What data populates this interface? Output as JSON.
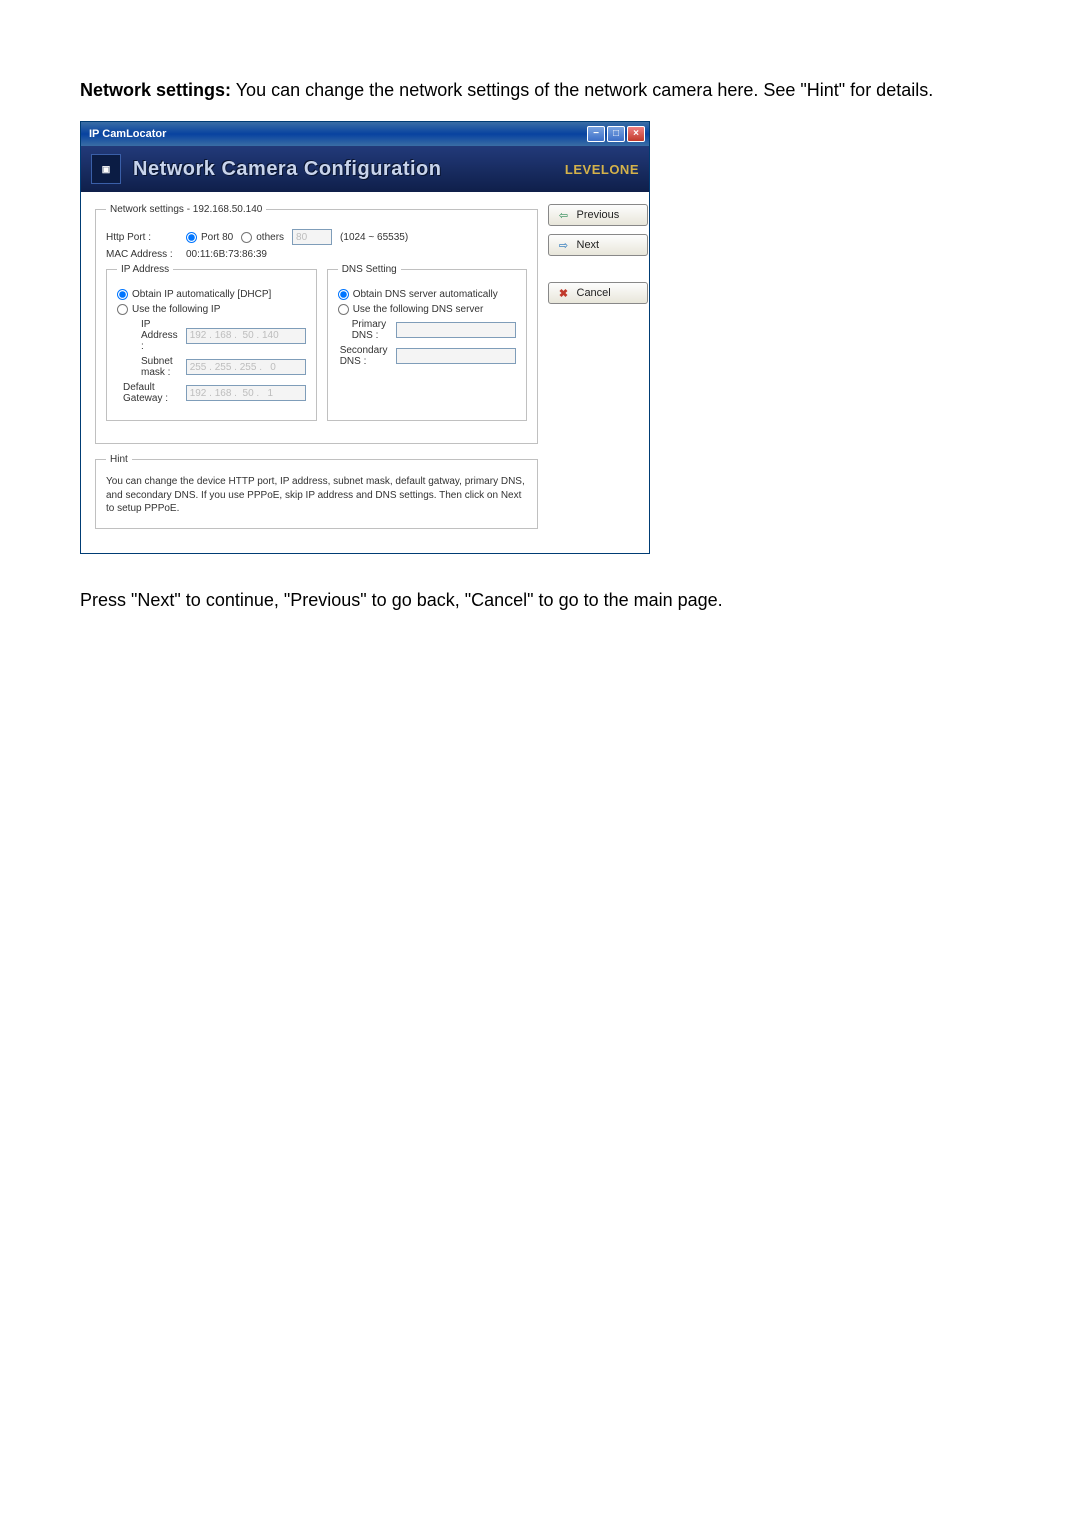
{
  "page": {
    "intro_bold": "Network settings:",
    "intro_rest": " You can change the network settings of the network camera here. See \"Hint\" for details.",
    "outro": "Press \"Next\" to continue, \"Previous\" to go back, \"Cancel\" to go to the main page."
  },
  "window": {
    "title": "IP CamLocator",
    "banner_title": "Network Camera Configuration",
    "brand": "LEVELONE"
  },
  "nav": {
    "previous": "Previous",
    "next": "Next",
    "cancel": "Cancel"
  },
  "network": {
    "legend": "Network settings - 192.168.50.140",
    "http_port_label": "Http Port :",
    "port80_label": "Port 80",
    "others_label": "others",
    "others_value": "80",
    "range_hint": "(1024 ~ 65535)",
    "mac_label": "MAC Address :",
    "mac_value": "00:11:6B:73:86:39"
  },
  "ip": {
    "legend": "IP Address",
    "dhcp_label": "Obtain IP automatically [DHCP]",
    "static_label": "Use the following IP",
    "ip_label": "IP Address :",
    "ip_value": "192 . 168 .  50 . 140",
    "subnet_label": "Subnet mask :",
    "subnet_value": "255 . 255 . 255 .   0",
    "gateway_label": "Default Gateway :",
    "gateway_value": "192 . 168 .  50 .   1"
  },
  "dns": {
    "legend": "DNS Setting",
    "auto_label": "Obtain DNS server automatically",
    "static_label": "Use the following DNS server",
    "primary_label": "Primary DNS :",
    "primary_value": "",
    "secondary_label": "Secondary DNS :",
    "secondary_value": ""
  },
  "hint": {
    "legend": "Hint",
    "text": "You can change the device HTTP port, IP address, subnet mask, default gatway, primary DNS, and secondary DNS. If you use PPPoE, skip IP address and DNS settings. Then click on Next to setup PPPoE."
  }
}
